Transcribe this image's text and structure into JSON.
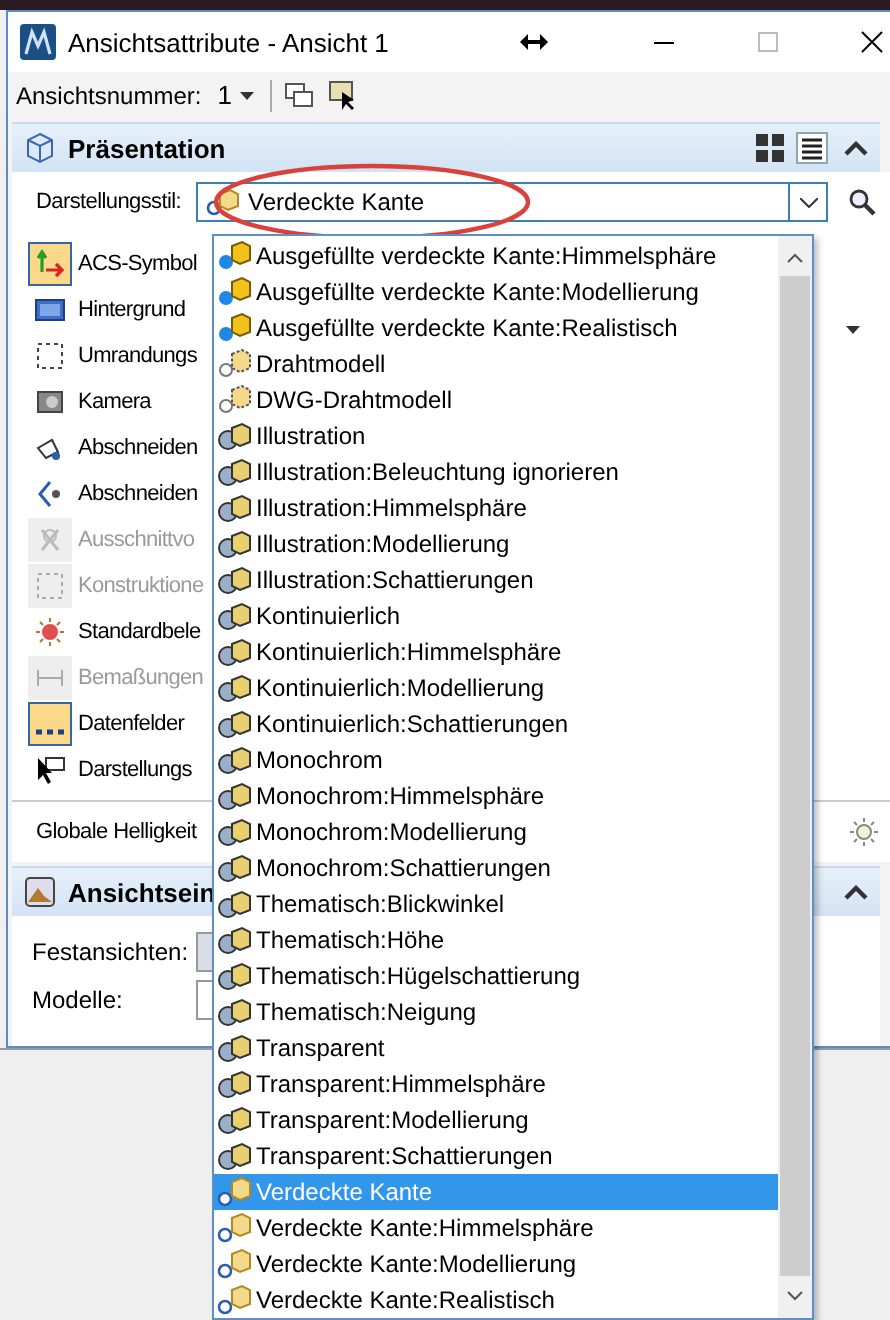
{
  "window": {
    "title": "Ansichtsattribute - Ansicht 1"
  },
  "toolbar": {
    "label": "Ansichtsnummer:",
    "value": "1"
  },
  "presentation": {
    "title": "Präsentation",
    "expanded": true,
    "style_label": "Darstellungsstil:",
    "style_value": "Verdeckte Kante",
    "items": [
      {
        "label": "ACS-Symbol",
        "kind": "acs",
        "checked": true,
        "disabled": false
      },
      {
        "label": "Hintergrund",
        "kind": "background",
        "checked": false,
        "disabled": false
      },
      {
        "label": "Umrandungs",
        "kind": "frame",
        "checked": false,
        "disabled": false
      },
      {
        "label": "Kamera",
        "kind": "camera",
        "checked": false,
        "disabled": false
      },
      {
        "label": "Abschneiden",
        "kind": "clipfront",
        "checked": false,
        "disabled": false
      },
      {
        "label": "Abschneiden",
        "kind": "clipback",
        "checked": false,
        "disabled": false
      },
      {
        "label": "Ausschnittvo",
        "kind": "volume",
        "checked": false,
        "disabled": true
      },
      {
        "label": "Konstruktione",
        "kind": "frame",
        "checked": false,
        "disabled": true
      },
      {
        "label": "Standardbele",
        "kind": "light",
        "checked": false,
        "disabled": false
      },
      {
        "label": "Bemaßungen",
        "kind": "dimension",
        "checked": false,
        "disabled": true
      },
      {
        "label": "Datenfelder",
        "kind": "fields",
        "checked": true,
        "disabled": false
      },
      {
        "label": "Darstellungs",
        "kind": "pointer",
        "checked": false,
        "disabled": false
      }
    ],
    "brightness_label": "Globale Helligkeit"
  },
  "view_settings": {
    "title": "Ansichtsein",
    "rows": [
      {
        "label": "Festansichten:"
      },
      {
        "label": "Modelle:"
      }
    ]
  },
  "dropdown": {
    "options": [
      {
        "label": "Ausgefüllte verdeckte Kante:Himmelsphäre",
        "kind": "filled",
        "selected": false
      },
      {
        "label": "Ausgefüllte verdeckte Kante:Modellierung",
        "kind": "filled",
        "selected": false
      },
      {
        "label": "Ausgefüllte verdeckte Kante:Realistisch",
        "kind": "filled",
        "selected": false
      },
      {
        "label": "Drahtmodell",
        "kind": "wire",
        "selected": false
      },
      {
        "label": "DWG-Drahtmodell",
        "kind": "wire",
        "selected": false
      },
      {
        "label": "Illustration",
        "kind": "shaded",
        "selected": false
      },
      {
        "label": "Illustration:Beleuchtung ignorieren",
        "kind": "shaded",
        "selected": false
      },
      {
        "label": "Illustration:Himmelsphäre",
        "kind": "shaded",
        "selected": false
      },
      {
        "label": "Illustration:Modellierung",
        "kind": "shaded",
        "selected": false
      },
      {
        "label": "Illustration:Schattierungen",
        "kind": "shaded",
        "selected": false
      },
      {
        "label": "Kontinuierlich",
        "kind": "shaded",
        "selected": false
      },
      {
        "label": "Kontinuierlich:Himmelsphäre",
        "kind": "shaded",
        "selected": false
      },
      {
        "label": "Kontinuierlich:Modellierung",
        "kind": "shaded",
        "selected": false
      },
      {
        "label": "Kontinuierlich:Schattierungen",
        "kind": "shaded",
        "selected": false
      },
      {
        "label": "Monochrom",
        "kind": "shaded",
        "selected": false
      },
      {
        "label": "Monochrom:Himmelsphäre",
        "kind": "shaded",
        "selected": false
      },
      {
        "label": "Monochrom:Modellierung",
        "kind": "shaded",
        "selected": false
      },
      {
        "label": "Monochrom:Schattierungen",
        "kind": "shaded",
        "selected": false
      },
      {
        "label": "Thematisch:Blickwinkel",
        "kind": "shaded",
        "selected": false
      },
      {
        "label": "Thematisch:Höhe",
        "kind": "shaded",
        "selected": false
      },
      {
        "label": "Thematisch:Hügelschattierung",
        "kind": "shaded",
        "selected": false
      },
      {
        "label": "Thematisch:Neigung",
        "kind": "shaded",
        "selected": false
      },
      {
        "label": "Transparent",
        "kind": "shaded",
        "selected": false
      },
      {
        "label": "Transparent:Himmelsphäre",
        "kind": "shaded",
        "selected": false
      },
      {
        "label": "Transparent:Modellierung",
        "kind": "shaded",
        "selected": false
      },
      {
        "label": "Transparent:Schattierungen",
        "kind": "shaded",
        "selected": false
      },
      {
        "label": "Verdeckte Kante",
        "kind": "hidden",
        "selected": true
      },
      {
        "label": "Verdeckte Kante:Himmelsphäre",
        "kind": "hidden",
        "selected": false
      },
      {
        "label": "Verdeckte Kante:Modellierung",
        "kind": "hidden",
        "selected": false
      },
      {
        "label": "Verdeckte Kante:Realistisch",
        "kind": "hidden",
        "selected": false
      }
    ]
  }
}
